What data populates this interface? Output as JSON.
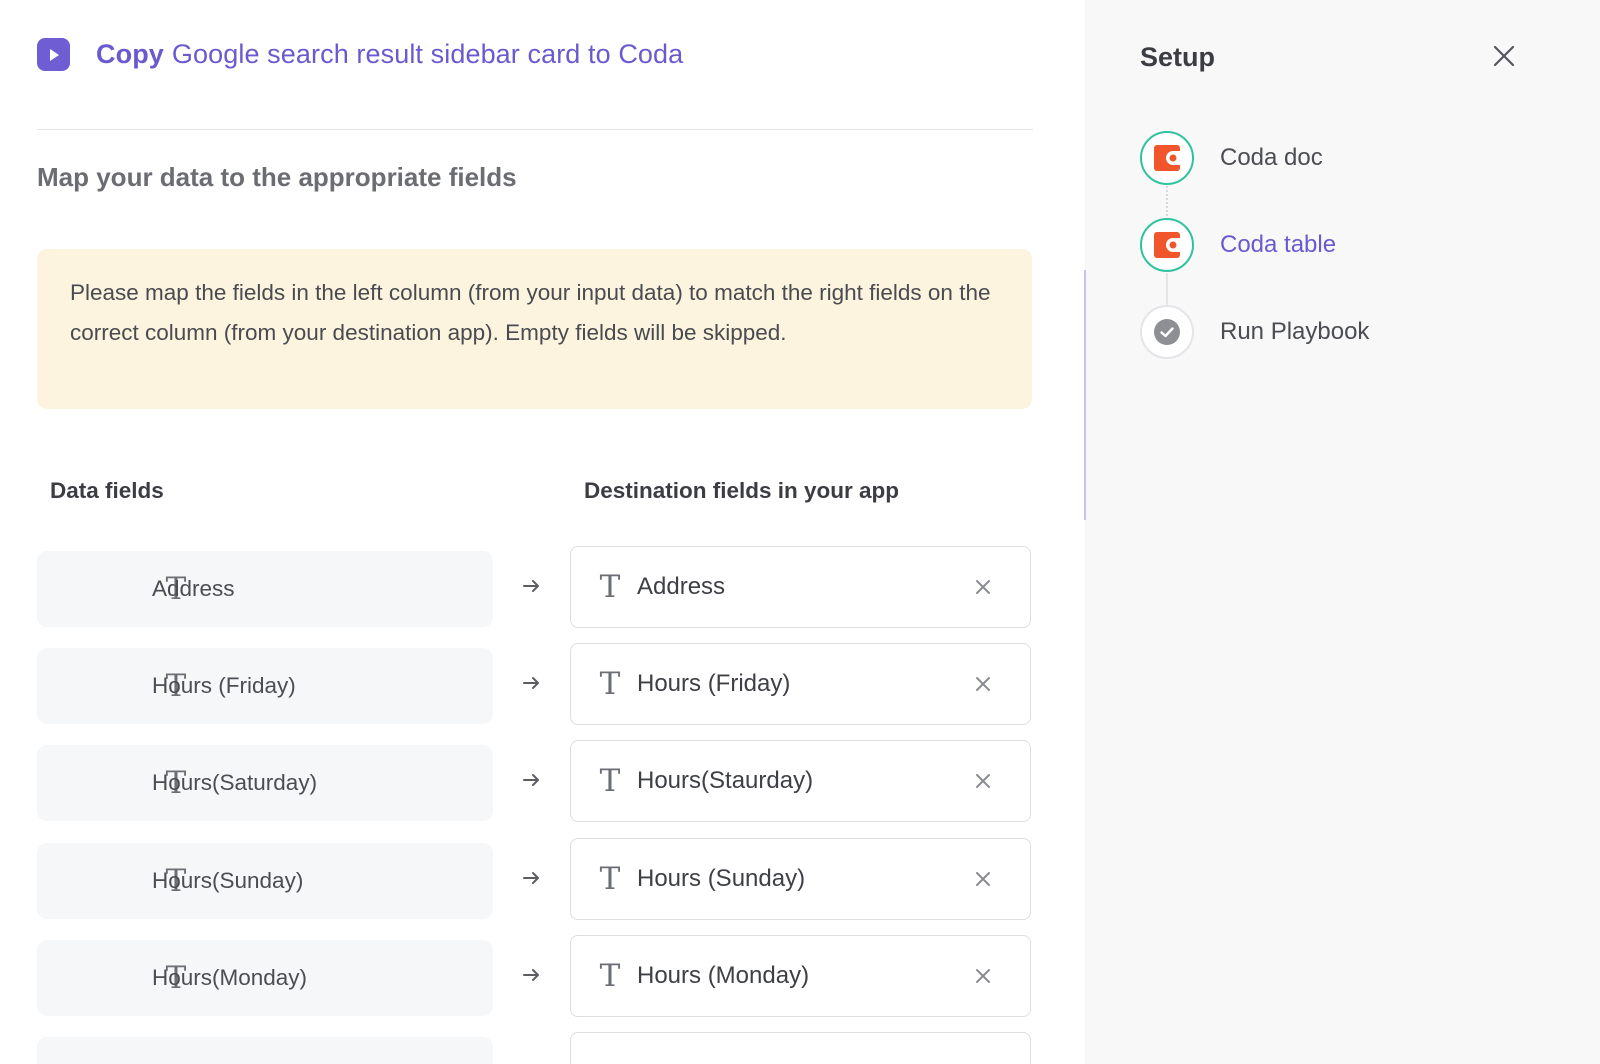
{
  "header": {
    "verb": "Copy",
    "title": "Google search result sidebar card to Coda",
    "icon": "play-icon",
    "accent_color": "#6f5dd3"
  },
  "main": {
    "section_title": "Map your data to the appropriate fields",
    "notice": "Please map the fields in the left column (from your input data) to match the right fields on the correct column (from your destination app). Empty fields will be skipped.",
    "columns": {
      "data": "Data fields",
      "destination": "Destination fields in your app"
    },
    "mappings": [
      {
        "source": "Address",
        "destination": "Address"
      },
      {
        "source": "Hours (Friday)",
        "destination": "Hours (Friday)"
      },
      {
        "source": "Hours(Saturday)",
        "destination": "Hours(Staurday)"
      },
      {
        "source": "Hours(Sunday)",
        "destination": "Hours (Sunday)"
      },
      {
        "source": "Hours(Monday)",
        "destination": "Hours (Monday)"
      }
    ]
  },
  "sidebar": {
    "title": "Setup",
    "steps": [
      {
        "label": "Coda doc",
        "status": "done",
        "icon": "coda-icon"
      },
      {
        "label": "Coda table",
        "status": "active",
        "icon": "coda-icon"
      },
      {
        "label": "Run Playbook",
        "status": "pending",
        "icon": "check-circle-icon"
      }
    ],
    "colors": {
      "done_ring": "#2ec39c",
      "coda_brand": "#f0552b",
      "active_text": "#6a5ad0"
    }
  }
}
